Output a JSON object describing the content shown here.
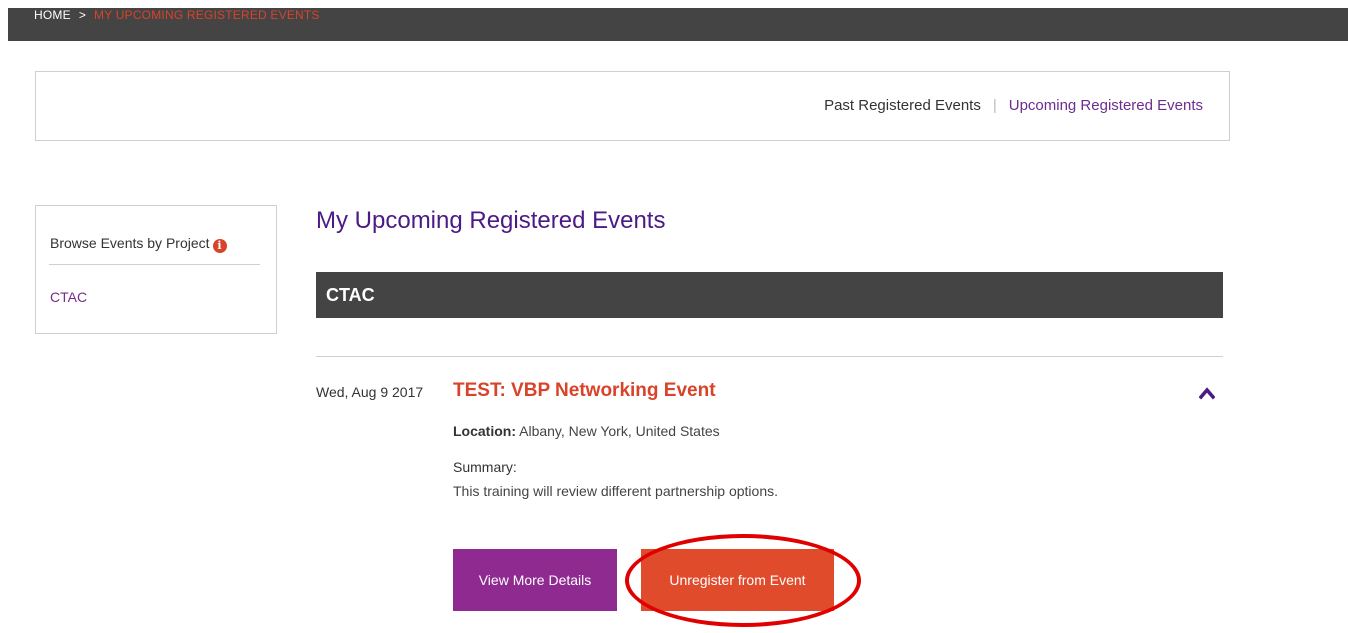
{
  "breadcrumb": {
    "home": "HOME",
    "separator": ">",
    "current": "MY UPCOMING REGISTERED EVENTS"
  },
  "tabs": {
    "past": "Past Registered Events",
    "divider": "|",
    "upcoming": "Upcoming Registered Events"
  },
  "sidebar": {
    "title": "Browse Events by Project",
    "info_icon": "i",
    "projects": [
      "CTAC"
    ]
  },
  "main": {
    "title": "My Upcoming Registered Events",
    "project_label": "CTAC",
    "event": {
      "date": "Wed, Aug 9 2017",
      "title": "TEST: VBP Networking Event",
      "location_label": "Location:",
      "location_value": "Albany, New York, United States",
      "summary_label": "Summary:",
      "summary_text": "This training will review different partnership options.",
      "buttons": {
        "details": "View More Details",
        "unregister": "Unregister from Event"
      }
    }
  },
  "icons": {
    "info": "info-icon",
    "collapse": "chevron-up-icon"
  },
  "colors": {
    "header_bg": "#444444",
    "accent_red": "#d9432a",
    "accent_purple": "#4b1a86",
    "link_purple": "#7a2b8a",
    "details_button": "#8e2a90",
    "unregister_button": "#e04b2b",
    "highlight": "#e10000"
  }
}
